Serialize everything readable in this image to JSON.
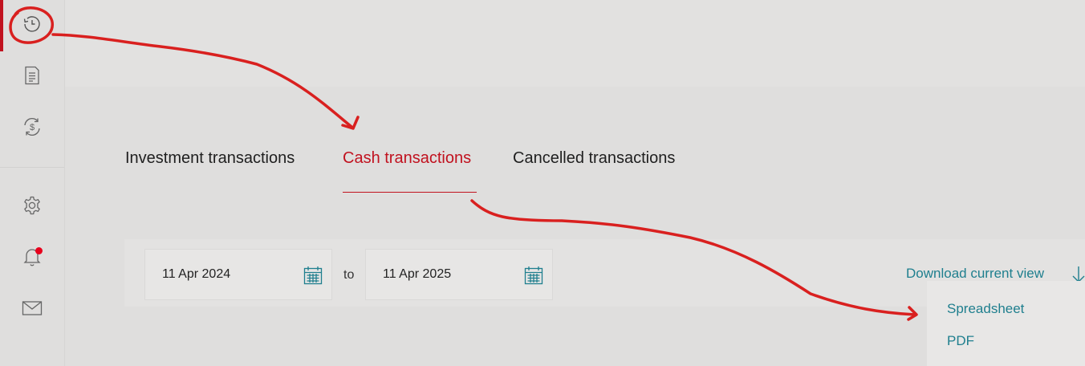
{
  "sidebar": {
    "items": [
      {
        "icon": "history-icon"
      },
      {
        "icon": "document-icon"
      },
      {
        "icon": "currency-exchange-icon"
      },
      {
        "icon": "gear-icon"
      },
      {
        "icon": "bell-icon",
        "has_notification": true
      },
      {
        "icon": "mail-icon"
      }
    ]
  },
  "tabs": [
    {
      "label": "Investment transactions",
      "active": false
    },
    {
      "label": "Cash transactions",
      "active": true
    },
    {
      "label": "Cancelled transactions",
      "active": false
    }
  ],
  "filters": {
    "from_date": "11 Apr 2024",
    "to_label": "to",
    "to_date": "11 Apr 2025"
  },
  "download": {
    "label": "Download current view",
    "options": [
      "Spreadsheet",
      "PDF"
    ]
  },
  "colors": {
    "accent": "#c1121f",
    "link": "#1f7f8e",
    "annotation": "#d9201f",
    "badge": "#e8001c"
  }
}
